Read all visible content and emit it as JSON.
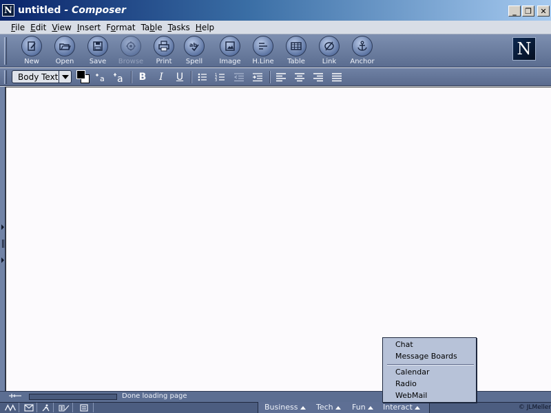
{
  "window": {
    "title_doc": "untitled",
    "title_sep": "-",
    "title_app": "Composer",
    "minimize_glyph": "_",
    "restore_glyph": "❐",
    "close_glyph": "✕"
  },
  "menubar": {
    "items": [
      {
        "label_u": "F",
        "label_rest": "ile"
      },
      {
        "label_u": "E",
        "label_rest": "dit"
      },
      {
        "label_u": "V",
        "label_rest": "iew"
      },
      {
        "label_u": "I",
        "label_rest": "nsert"
      },
      {
        "label_pre": "F",
        "label_u": "o",
        "label_rest": "rmat"
      },
      {
        "label_pre": "Ta",
        "label_u": "b",
        "label_rest": "le"
      },
      {
        "label_u": "T",
        "label_rest": "asks"
      },
      {
        "label_u": "H",
        "label_rest": "elp"
      }
    ]
  },
  "toolbar": {
    "buttons": [
      {
        "label": "New",
        "icon": "new-document-icon"
      },
      {
        "label": "Open",
        "icon": "open-folder-icon"
      },
      {
        "label": "Save",
        "icon": "floppy-disk-icon"
      },
      {
        "label": "Browse",
        "icon": "browse-wheel-icon",
        "disabled": true
      },
      {
        "label": "Print",
        "icon": "printer-icon"
      },
      {
        "label": "Spell",
        "icon": "spell-check-icon"
      },
      {
        "label": "Image",
        "icon": "image-icon"
      },
      {
        "label": "H.Line",
        "icon": "horizontal-line-icon"
      },
      {
        "label": "Table",
        "icon": "table-icon"
      },
      {
        "label": "Link",
        "icon": "link-icon"
      },
      {
        "label": "Anchor",
        "icon": "anchor-icon"
      }
    ],
    "logo_letter": "N"
  },
  "format_toolbar": {
    "paragraph_style": "Body Text",
    "bold": "B",
    "italic": "I",
    "underline": "U",
    "text_color": "#000000",
    "background_color": "#ffffff"
  },
  "status": {
    "text": "Done loading page"
  },
  "taskbar": {
    "categories": [
      "Business",
      "Tech",
      "Fun",
      "Interact"
    ],
    "copyright": "© JLMeller"
  },
  "popup_menu": {
    "items_top": [
      "Chat",
      "Message Boards"
    ],
    "items_bottom": [
      "Calendar",
      "Radio",
      "WebMail"
    ]
  },
  "colors": {
    "titlebar_start": "#0a246a",
    "toolbar": "#6b7ea3",
    "editor_bg": "#fcfafd"
  }
}
